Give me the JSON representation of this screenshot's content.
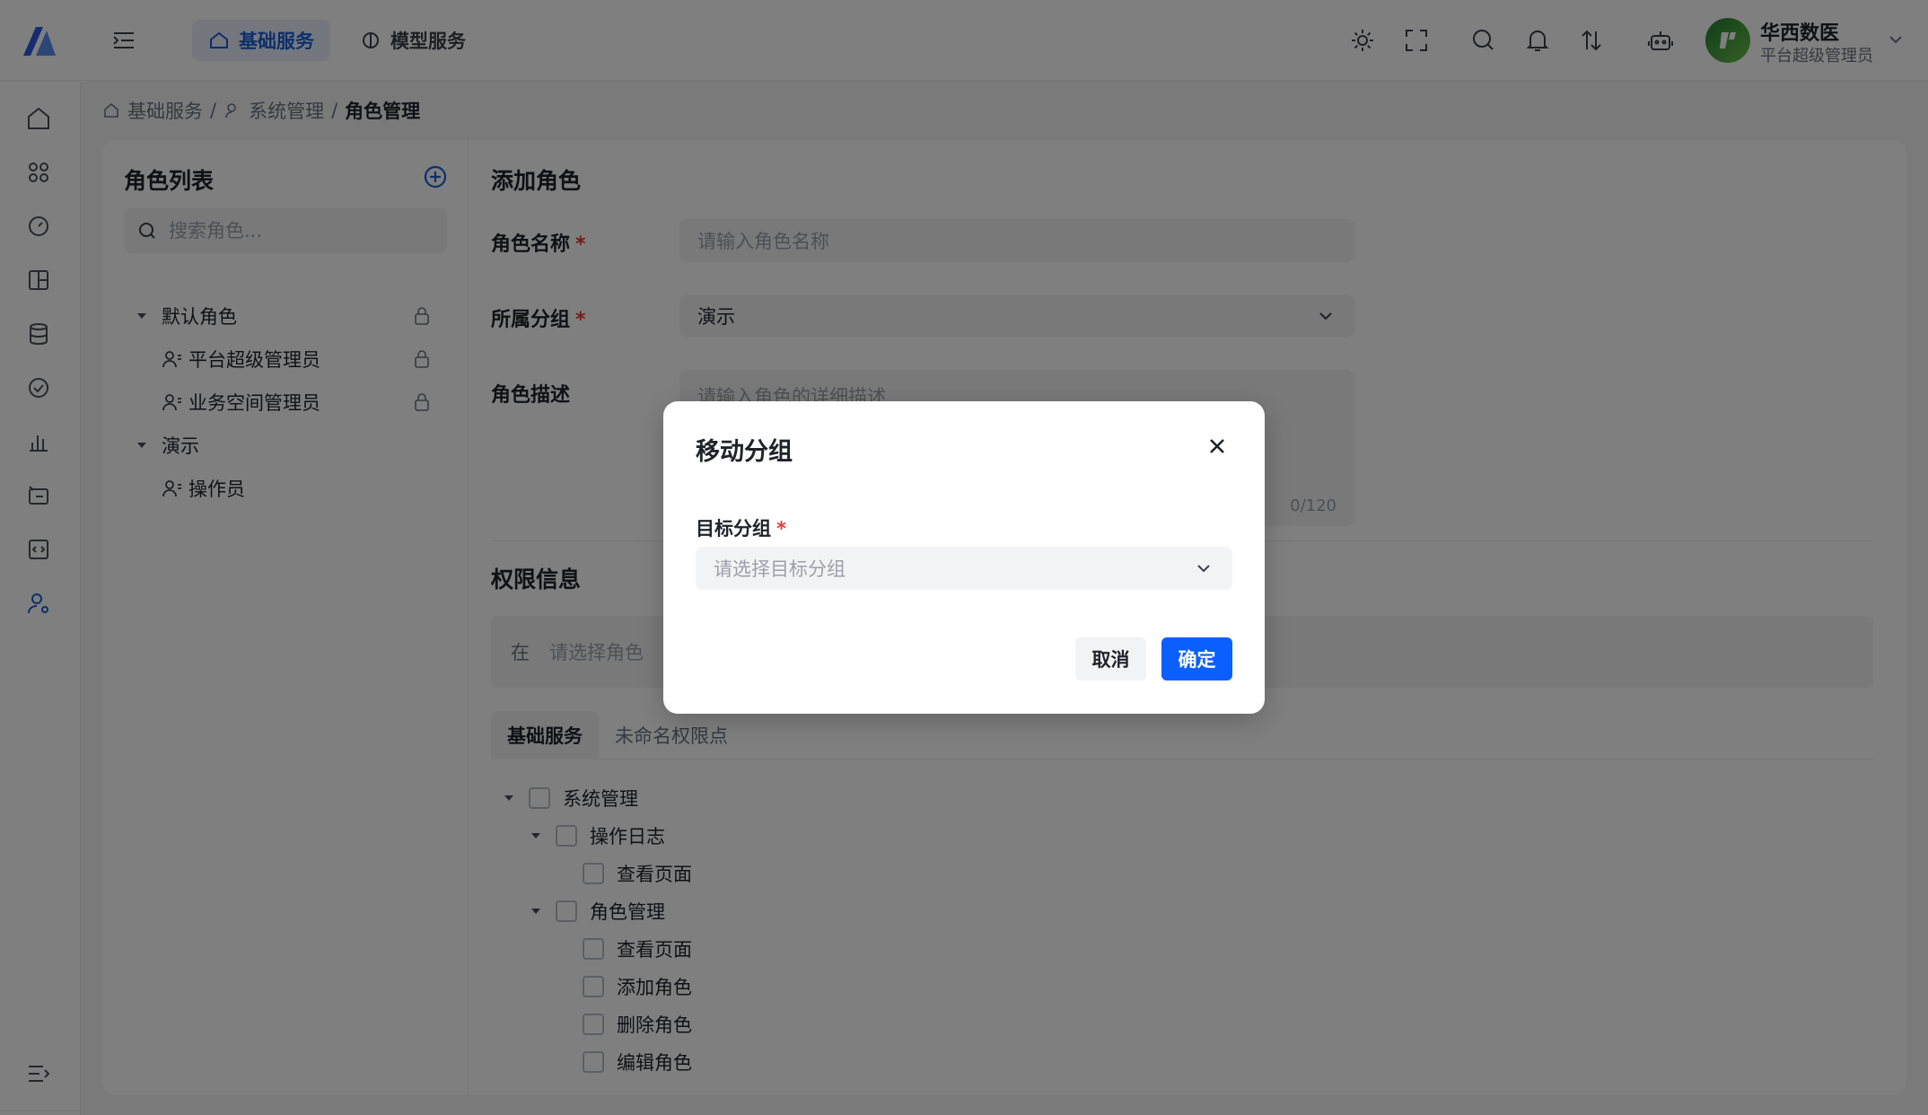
{
  "header": {
    "menu_toggle_icon": "indent-icon",
    "tabs": [
      {
        "label": "基础服务",
        "icon": "home-icon",
        "active": true
      },
      {
        "label": "模型服务",
        "icon": "brain-icon",
        "active": false
      }
    ],
    "icons": [
      "sun-icon",
      "fullscreen-icon",
      "search-icon",
      "bell-icon",
      "sort-icon",
      "robot-icon"
    ],
    "user": {
      "name": "华西数医",
      "role": "平台超级管理员"
    }
  },
  "sidebar": {
    "items": [
      "home-icon",
      "apps-icon",
      "dashboard-icon",
      "layout-icon",
      "database-icon",
      "check-circle-icon",
      "bar-chart-icon",
      "tag-icon",
      "code-icon",
      "user-settings-icon"
    ],
    "bottom": "collapse-icon"
  },
  "breadcrumb": {
    "items": [
      "基础服务",
      "系统管理",
      "角色管理"
    ],
    "separator": "/"
  },
  "role_list": {
    "title": "角色列表",
    "search_placeholder": "搜索角色...",
    "groups": [
      {
        "name": "默认角色",
        "locked": true,
        "roles": [
          {
            "name": "平台超级管理员",
            "locked": true
          },
          {
            "name": "业务空间管理员",
            "locked": true
          }
        ]
      },
      {
        "name": "演示",
        "locked": false,
        "roles": [
          {
            "name": "操作员",
            "locked": false
          }
        ]
      }
    ]
  },
  "form": {
    "title": "添加角色",
    "name_label": "角色名称",
    "name_placeholder": "请输入角色名称",
    "group_label": "所属分组",
    "group_value": "演示",
    "desc_label": "角色描述",
    "desc_placeholder": "请输入角色的详细描述",
    "desc_count": "0/120",
    "required_mark": "*"
  },
  "permissions": {
    "title": "权限信息",
    "prefix": "在",
    "select_placeholder": "请选择角色",
    "tabs": [
      {
        "label": "基础服务",
        "active": true
      },
      {
        "label": "未命名权限点",
        "active": false
      }
    ],
    "tree": [
      {
        "label": "系统管理"
      },
      {
        "label": "操作日志"
      },
      {
        "label": "查看页面"
      },
      {
        "label": "角色管理"
      },
      {
        "label": "查看页面"
      },
      {
        "label": "添加角色"
      },
      {
        "label": "删除角色"
      },
      {
        "label": "编辑角色"
      }
    ]
  },
  "modal": {
    "title": "移动分组",
    "field_label": "目标分组",
    "required_mark": "*",
    "select_placeholder": "请选择目标分组",
    "cancel_label": "取消",
    "confirm_label": "确定"
  },
  "colors": {
    "accent": "#0b5fff",
    "active_tab_bg": "#e8effc",
    "required": "#e53935"
  }
}
